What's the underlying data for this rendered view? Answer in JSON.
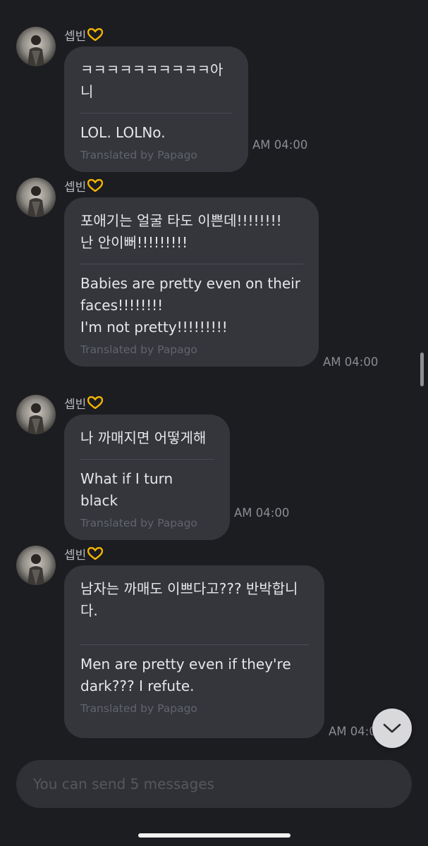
{
  "chat": {
    "messages": [
      {
        "sender": "셉빈",
        "sender_emoji": "heart-hands-emoji",
        "original": "ㅋㅋㅋㅋㅋㅋㅋㅋㅋㅋ아니",
        "translation": "LOL. LOLNo.",
        "credit": "Translated by Papago",
        "time": "AM 04:00"
      },
      {
        "sender": "셉빈",
        "sender_emoji": "heart-hands-emoji",
        "original": "포애기는 얼굴 타도 이쁜데!!!!!!!!\n난 안이뻐!!!!!!!!!",
        "translation": "Babies are pretty even on their faces!!!!!!!!\nI'm not pretty!!!!!!!!!",
        "credit": "Translated by Papago",
        "time": "AM 04:00"
      },
      {
        "sender": "셉빈",
        "sender_emoji": "heart-hands-emoji",
        "original": "나 까매지면 어떻게해",
        "translation": "What if I turn black",
        "credit": "Translated by Papago",
        "time": "AM 04:00"
      },
      {
        "sender": "셉빈",
        "sender_emoji": "heart-hands-emoji",
        "original": "남자는 까매도 이쁘다고??? 반박합니다.",
        "translation": "Men are pretty even if they're dark??? I refute.",
        "credit": "Translated by Papago",
        "time": "AM 04:00"
      }
    ]
  },
  "composer": {
    "placeholder": "You can send 5 messages"
  },
  "icons": {
    "scroll_down": "chevron-down-icon"
  },
  "colors": {
    "background": "#1c1d21",
    "bubble": "#34363c",
    "message_text": "#e6e7ea",
    "credit_text": "#62646b",
    "time_text": "#8a8c92"
  }
}
